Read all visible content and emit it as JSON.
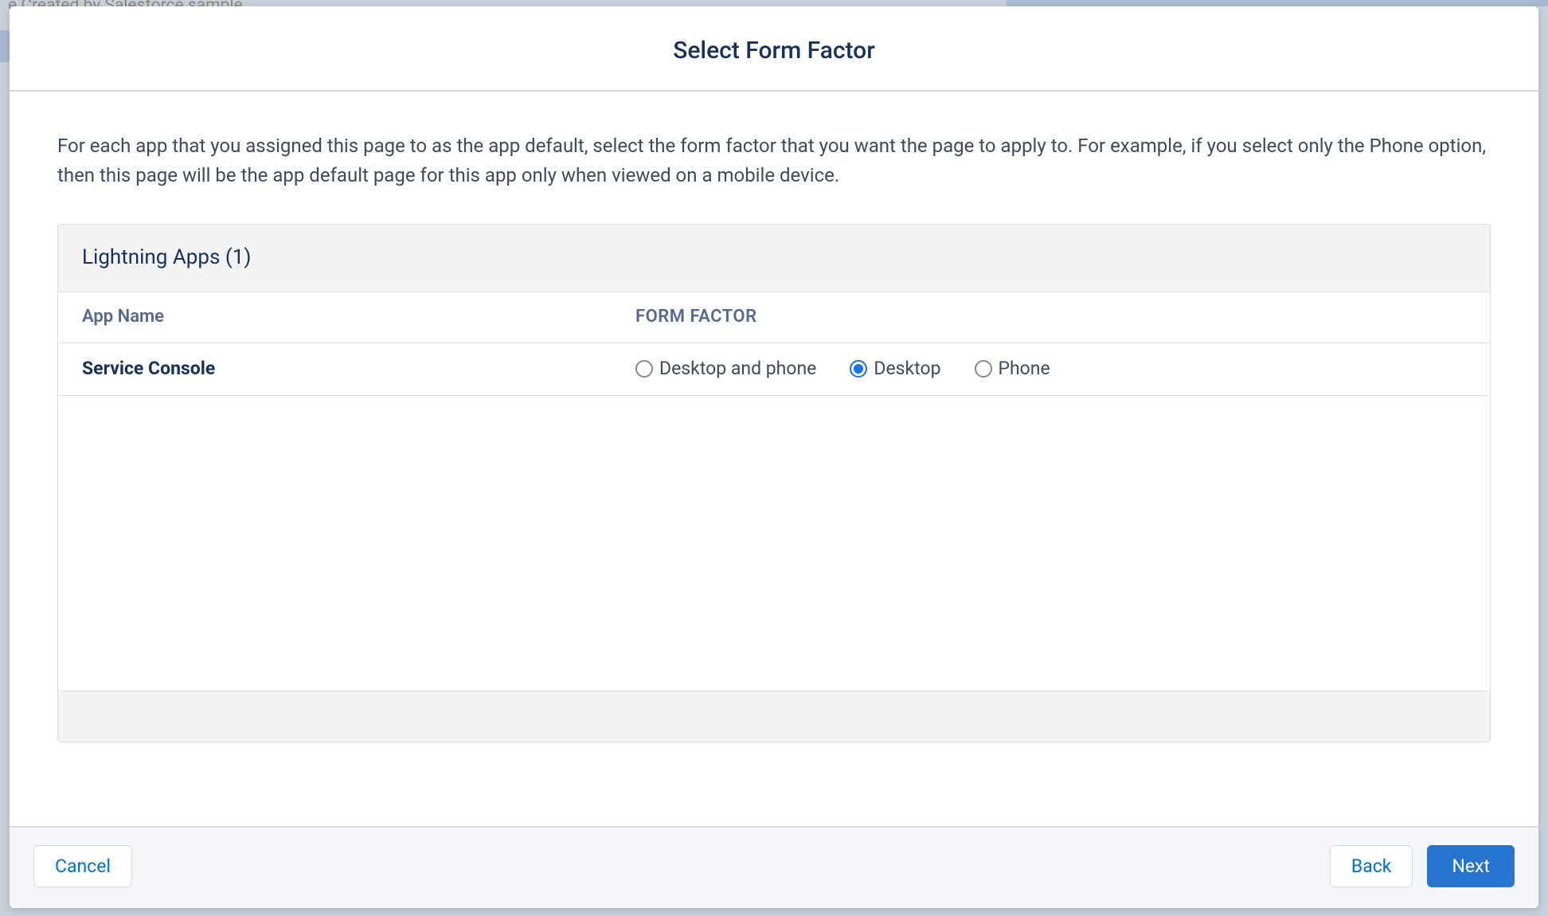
{
  "background": {
    "partial_text": "e Created by Salesforce sample"
  },
  "modal": {
    "title": "Select Form Factor",
    "description": "For each app that you assigned this page to as the app default, select the form factor that you want the page to apply to. For example, if you select only the Phone option, then this page will be the app default page for this app only when viewed on a mobile device.",
    "table": {
      "section_title": "Lightning Apps (1)",
      "columns": {
        "app_name": "App Name",
        "form_factor": "FORM FACTOR"
      },
      "rows": [
        {
          "app_name": "Service Console",
          "options": [
            {
              "label": "Desktop and phone",
              "selected": false
            },
            {
              "label": "Desktop",
              "selected": true
            },
            {
              "label": "Phone",
              "selected": false
            }
          ]
        }
      ]
    },
    "footer": {
      "cancel": "Cancel",
      "back": "Back",
      "next": "Next"
    }
  }
}
